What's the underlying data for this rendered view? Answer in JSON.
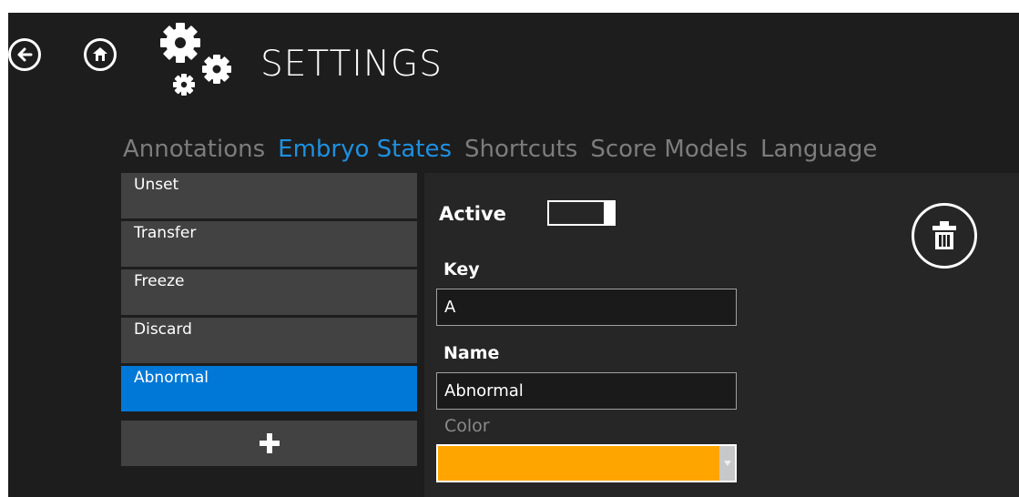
{
  "header": {
    "title": "SETTINGS",
    "back_icon": "back-arrow-icon",
    "home_icon": "home-icon",
    "settings_icon": "gears-icon"
  },
  "tabs": [
    {
      "label": "Annotations",
      "active": false
    },
    {
      "label": "Embryo States",
      "active": true
    },
    {
      "label": "Shortcuts",
      "active": false
    },
    {
      "label": "Score Models",
      "active": false
    },
    {
      "label": "Language",
      "active": false
    }
  ],
  "states": [
    {
      "label": "Unset",
      "selected": false
    },
    {
      "label": "Transfer",
      "selected": false
    },
    {
      "label": "Freeze",
      "selected": false
    },
    {
      "label": "Discard",
      "selected": false
    },
    {
      "label": "Abnormal",
      "selected": true
    }
  ],
  "add_button_icon": "plus-icon",
  "detail": {
    "active_label": "Active",
    "active_on": true,
    "key_label": "Key",
    "key_value": "A",
    "name_label": "Name",
    "name_value": "Abnormal",
    "color_label": "Color",
    "color_value": "#ffa500",
    "delete_icon": "trash-icon"
  },
  "colors": {
    "accent": "#1e90e0",
    "selected_item": "#0078d7",
    "background": "#1d1d1d"
  }
}
